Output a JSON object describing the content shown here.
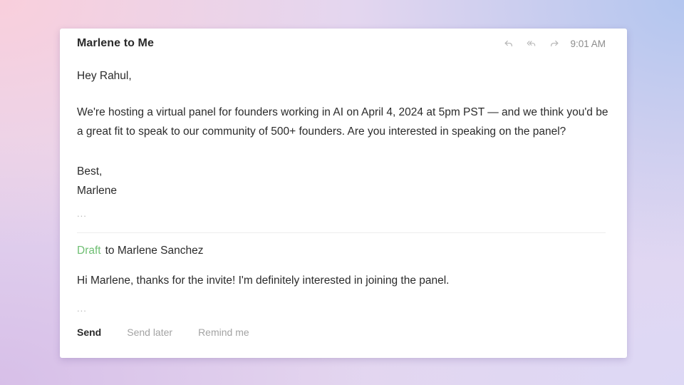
{
  "background": {
    "gradient_colors": [
      "#f9cfdc",
      "#b3c6ef",
      "#d7bfe8",
      "#ddd8f5"
    ]
  },
  "message": {
    "sender_line": "Marlene to Me",
    "time": "9:01 AM",
    "icons": [
      "reply-icon",
      "reply-all-icon",
      "forward-icon"
    ],
    "greeting": "Hey Rahul,",
    "body": "We're hosting a virtual panel for founders working in AI on April 4, 2024 at 5pm PST — and we think you'd be a great fit to speak to our community of 500+ founders. Are you interested in speaking on the panel?",
    "signoff": "Best,",
    "signature": "Marlene",
    "collapsed_indicator": "..."
  },
  "draft": {
    "label": "Draft",
    "label_color": "#6fbf73",
    "recipient_line": "to Marlene Sanchez",
    "body": "Hi Marlene, thanks for the invite! I'm definitely interested in joining the panel.",
    "collapsed_indicator": "..."
  },
  "actions": {
    "send": "Send",
    "send_later": "Send later",
    "remind_me": "Remind me"
  }
}
